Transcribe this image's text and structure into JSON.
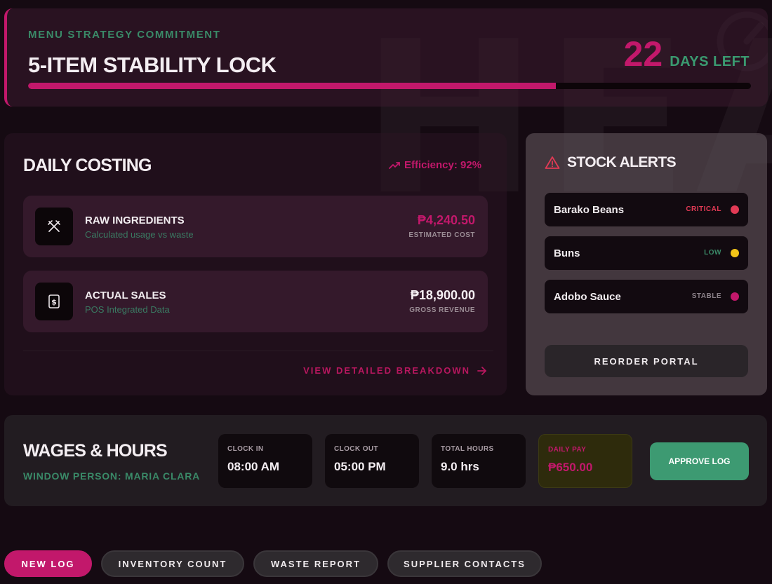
{
  "commitment": {
    "eyebrow": "MENU STRATEGY COMMITMENT",
    "title": "5-ITEM STABILITY LOCK",
    "days_left_value": "22",
    "days_left_label": "DAYS LEFT",
    "progress_fraction": 0.73,
    "watermark": "HEA"
  },
  "daily_costing": {
    "title": "DAILY COSTING",
    "efficiency": "Efficiency: 92%",
    "rows": [
      {
        "name": "RAW INGREDIENTS",
        "subtitle": "Calculated usage vs waste",
        "amount": "₱4,240.50",
        "caption": "ESTIMATED COST",
        "icon": "utensils-crossed-icon",
        "amount_color": "#c2186b"
      },
      {
        "name": "ACTUAL SALES",
        "subtitle": "POS Integrated Data",
        "amount": "₱18,900.00",
        "caption": "GROSS REVENUE",
        "icon": "dollar-receipt-icon",
        "amount_color": "#f4eef2"
      }
    ],
    "breakdown_link": "VIEW DETAILED BREAKDOWN"
  },
  "stock_alerts": {
    "title": "STOCK ALERTS",
    "items": [
      {
        "name": "Barako Beans",
        "status": "CRITICAL",
        "status_color": "#e23a55"
      },
      {
        "name": "Buns",
        "status": "LOW",
        "status_color": "#3a8a68",
        "dot_color": "#f2c418"
      },
      {
        "name": "Adobo Sauce",
        "status": "STABLE",
        "status_color": "#8a8088",
        "dot_color": "#c2186b"
      }
    ],
    "reorder_label": "REORDER PORTAL"
  },
  "wages": {
    "title": "WAGES & HOURS",
    "person": "WINDOW PERSON: MARIA CLARA",
    "clock_in_label": "CLOCK IN",
    "clock_in_value": "08:00 AM",
    "clock_out_label": "CLOCK OUT",
    "clock_out_value": "05:00 PM",
    "total_hours_label": "TOTAL HOURS",
    "total_hours_value": "9.0 hrs",
    "daily_pay_label": "DAILY PAY",
    "daily_pay_value": "₱650.00",
    "approve_label": "APPROVE LOG"
  },
  "tabs": [
    {
      "label": "NEW LOG",
      "active": true
    },
    {
      "label": "INVENTORY COUNT",
      "active": false
    },
    {
      "label": "WASTE REPORT",
      "active": false
    },
    {
      "label": "SUPPLIER CONTACTS",
      "active": false
    }
  ],
  "colors": {
    "accent": "#c2186b",
    "success": "#3d9a72",
    "background": "#150a12"
  }
}
